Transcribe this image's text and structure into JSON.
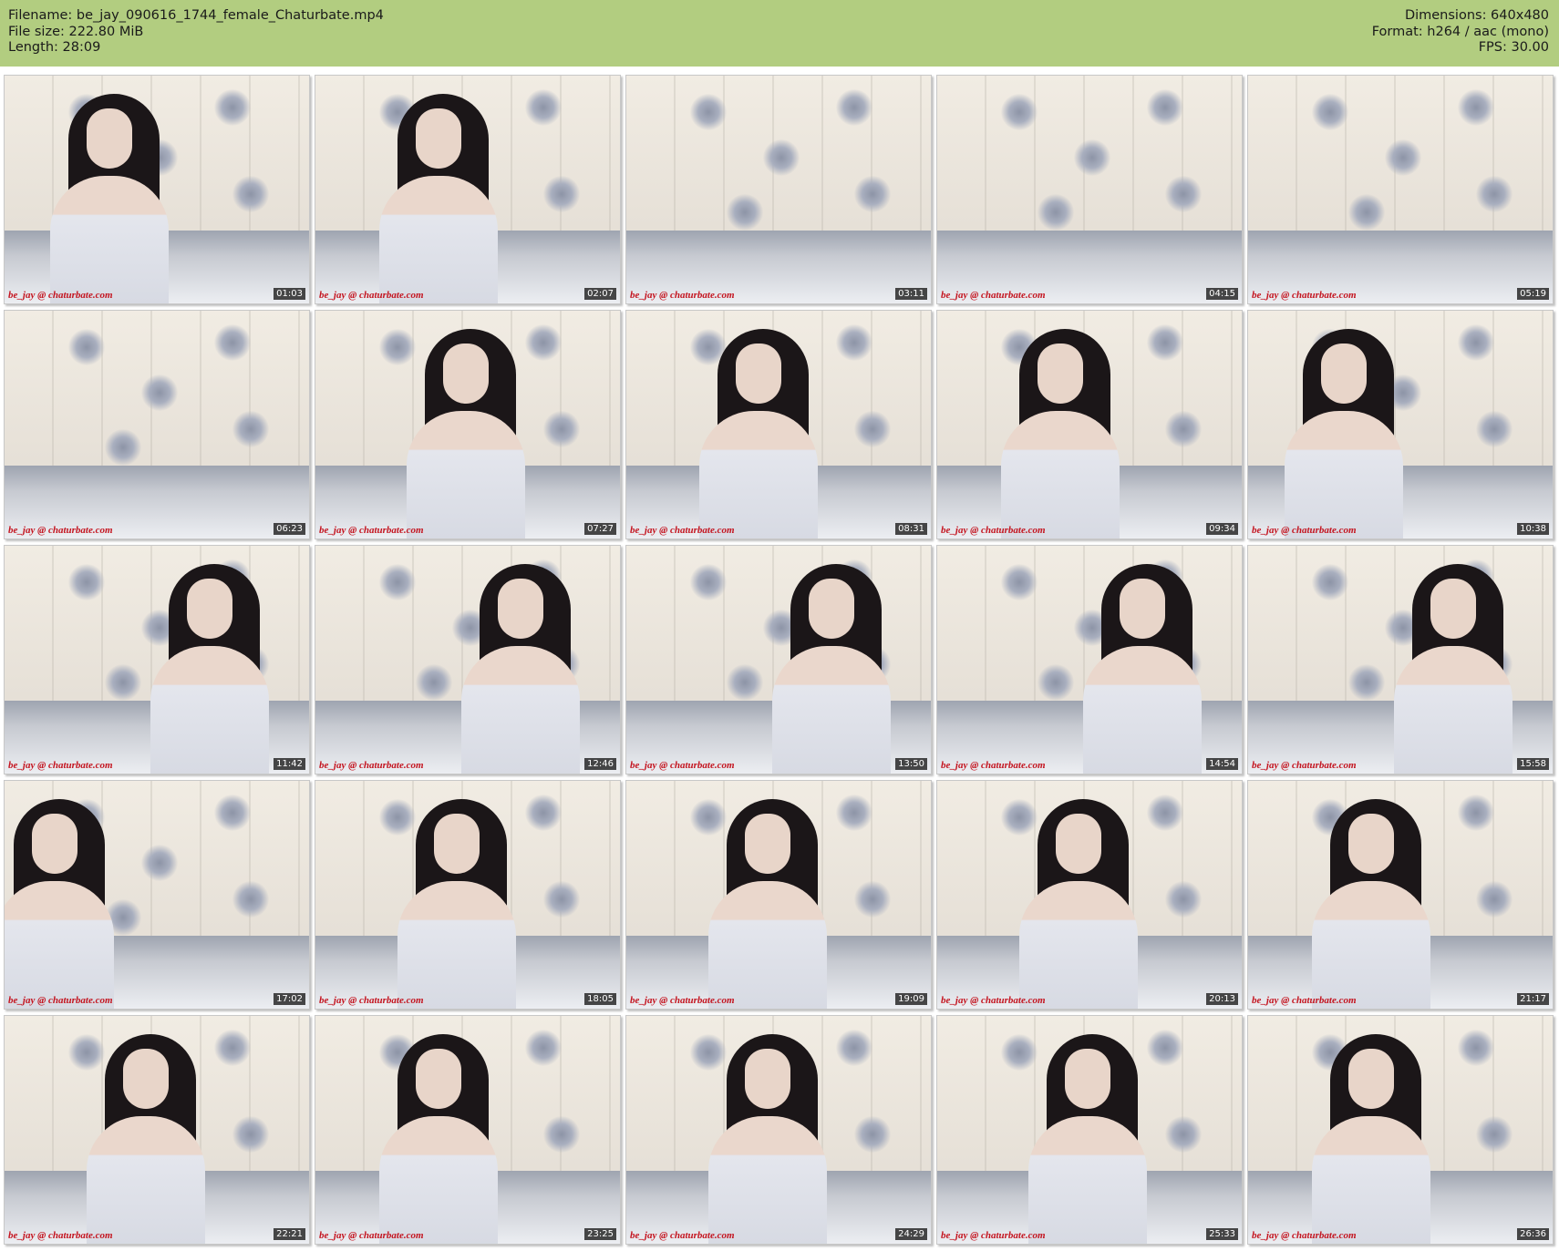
{
  "header": {
    "filename": "Filename: be_jay_090616_1744_female_Chaturbate.mp4",
    "filesize": "File size: 222.80 MiB",
    "length": "Length: 28:09",
    "dimensions": "Dimensions: 640x480",
    "format": "Format: h264 / aac (mono)",
    "fps": "FPS: 30.00"
  },
  "colors": {
    "header_bg": "#b2cd80",
    "watermark": "#c4141f"
  },
  "watermark_text": "be_jay @ chaturbate.com",
  "thumbnails": [
    {
      "time": "01:03"
    },
    {
      "time": "02:07"
    },
    {
      "time": "03:11"
    },
    {
      "time": "04:15"
    },
    {
      "time": "05:19"
    },
    {
      "time": "06:23"
    },
    {
      "time": "07:27"
    },
    {
      "time": "08:31"
    },
    {
      "time": "09:34"
    },
    {
      "time": "10:38"
    },
    {
      "time": "11:42"
    },
    {
      "time": "12:46"
    },
    {
      "time": "13:50"
    },
    {
      "time": "14:54"
    },
    {
      "time": "15:58"
    },
    {
      "time": "17:02"
    },
    {
      "time": "18:05"
    },
    {
      "time": "19:09"
    },
    {
      "time": "20:13"
    },
    {
      "time": "21:17"
    },
    {
      "time": "22:21"
    },
    {
      "time": "23:25"
    },
    {
      "time": "24:29"
    },
    {
      "time": "25:33"
    },
    {
      "time": "26:36"
    }
  ]
}
